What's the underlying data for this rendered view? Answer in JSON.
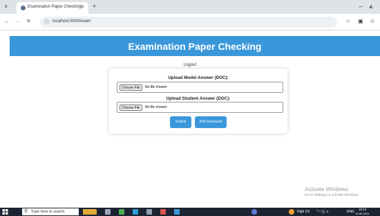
{
  "browser": {
    "tab_title": "Examination Paper Checking",
    "url": "localhost:5000/exam",
    "icons": [
      "tab-list-icon",
      "favicon-icon",
      "close-icon",
      "plus-icon",
      "back-icon",
      "forward-icon",
      "stop-icon",
      "site-info-icon",
      "star-icon",
      "sidebar-icon",
      "profile-icon"
    ]
  },
  "page": {
    "title": "Examination Paper Checking",
    "logout": "Logout",
    "model_label": "Upload Model Answer (DOC):",
    "student_label": "Upload Student Answer (DOC):",
    "choose_file": "Choose File",
    "no_file": "No file chosen",
    "submit": "Submit",
    "add_scorecard": "Add Scorecard",
    "accent_color": "#3a98da"
  },
  "watermark": {
    "title": "Activate Windows",
    "subtitle": "Go to Settings to activate Windows."
  },
  "taskbar": {
    "search_placeholder": "Type here to search",
    "weather": "High UV",
    "language": "ENG",
    "time": "10:12",
    "date": "10-09-2024"
  }
}
